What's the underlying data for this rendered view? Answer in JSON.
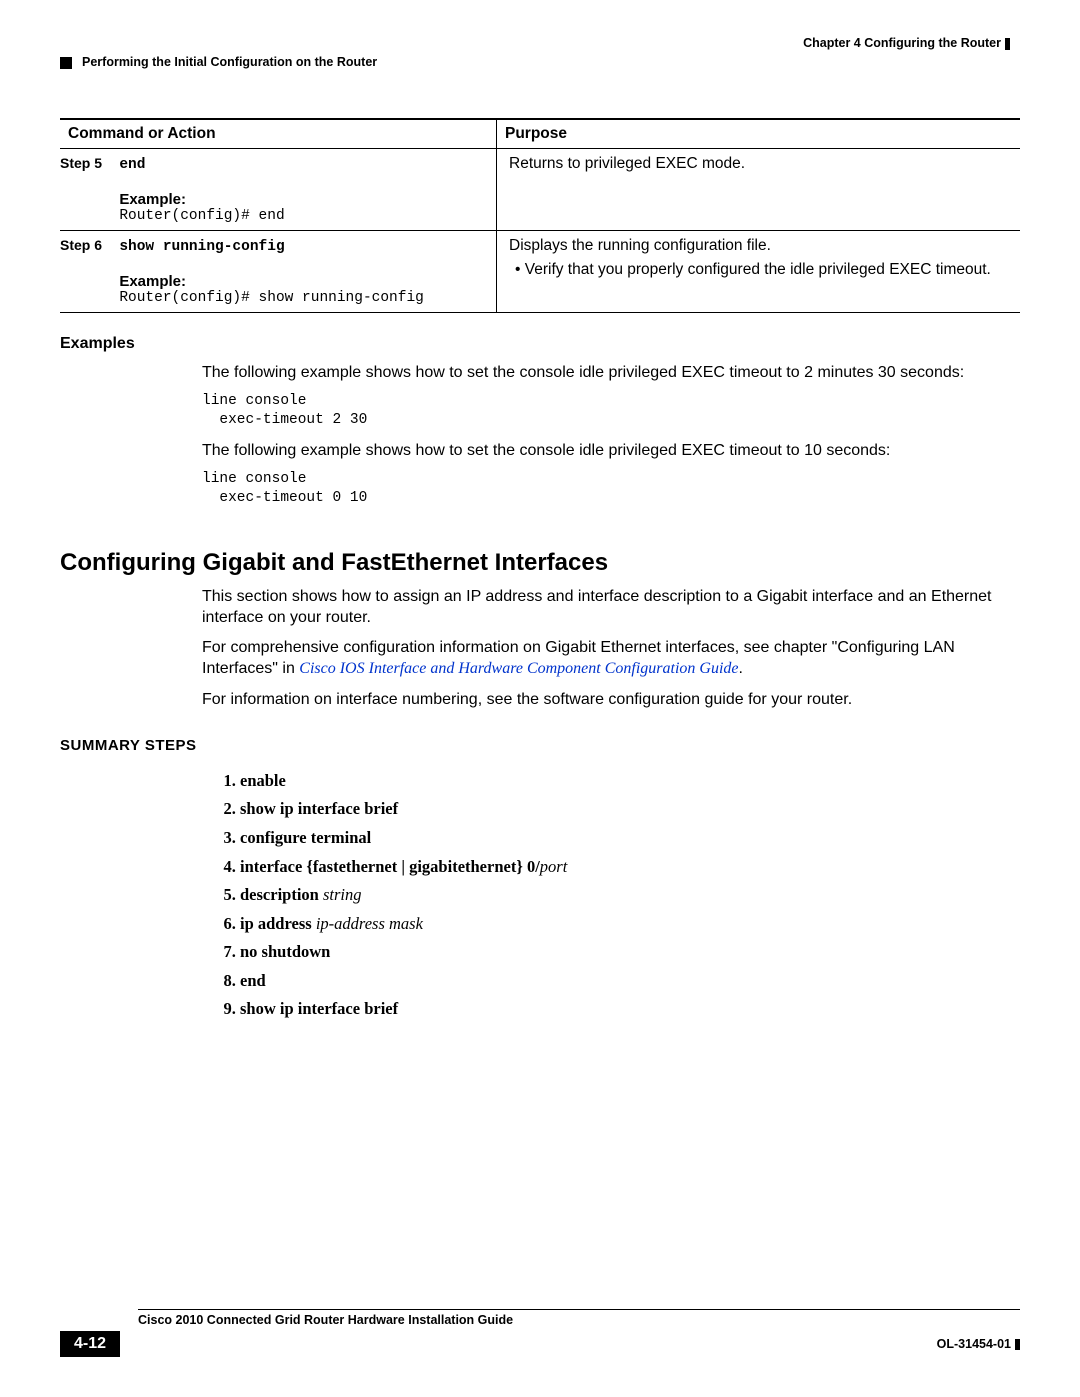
{
  "header": {
    "chapter": "Chapter 4    Configuring the Router",
    "section": "Performing the Initial Configuration on the Router"
  },
  "table": {
    "head_left": "Command or Action",
    "head_right": "Purpose",
    "rows": [
      {
        "step": "Step 5",
        "command": "end",
        "example_label": "Example:",
        "example_code": "Router(config)# end",
        "purpose_main": "Returns to privileged EXEC mode.",
        "bullets": []
      },
      {
        "step": "Step 6",
        "command": "show running-config",
        "example_label": "Example:",
        "example_code": "Router(config)# show running-config",
        "purpose_main": "Displays the running configuration file.",
        "bullets": [
          "Verify that you properly configured the idle privileged EXEC timeout."
        ]
      }
    ]
  },
  "examples": {
    "heading": "Examples",
    "para1": "The following example shows how to set the console idle privileged EXEC timeout to 2 minutes 30 seconds:",
    "code1": "line console\n  exec-timeout 2 30",
    "para2": "The following example shows how to set the console idle privileged EXEC timeout to 10 seconds:",
    "code2": "line console\n  exec-timeout 0 10"
  },
  "main_section": {
    "title": "Configuring Gigabit and FastEthernet Interfaces",
    "p1": "This section shows how to assign an IP address and interface description to a Gigabit interface and an Ethernet interface on your router.",
    "p2a": "For comprehensive configuration information on Gigabit Ethernet interfaces, see chapter \"Configuring LAN Interfaces\" in ",
    "p2link": "Cisco IOS Interface and Hardware Component Configuration Guide",
    "p2b": ".",
    "p3": "For information on interface numbering, see the software configuration guide for your router."
  },
  "summary": {
    "heading": "SUMMARY STEPS",
    "items": [
      {
        "bold": "enable",
        "arg": ""
      },
      {
        "bold": "show ip interface brief",
        "arg": ""
      },
      {
        "bold": "configure terminal",
        "arg": ""
      },
      {
        "bold": "interface {fastethernet | gigabitethernet} 0/",
        "arg": "port"
      },
      {
        "bold": "description ",
        "arg": "string"
      },
      {
        "bold": "ip address ",
        "arg": "ip-address mask"
      },
      {
        "bold": "no shutdown",
        "arg": ""
      },
      {
        "bold": "end",
        "arg": ""
      },
      {
        "bold": "show ip interface brief",
        "arg": ""
      }
    ]
  },
  "footer": {
    "book": "Cisco 2010 Connected Grid Router Hardware Installation Guide",
    "page": "4-12",
    "docid": "OL-31454-01"
  }
}
